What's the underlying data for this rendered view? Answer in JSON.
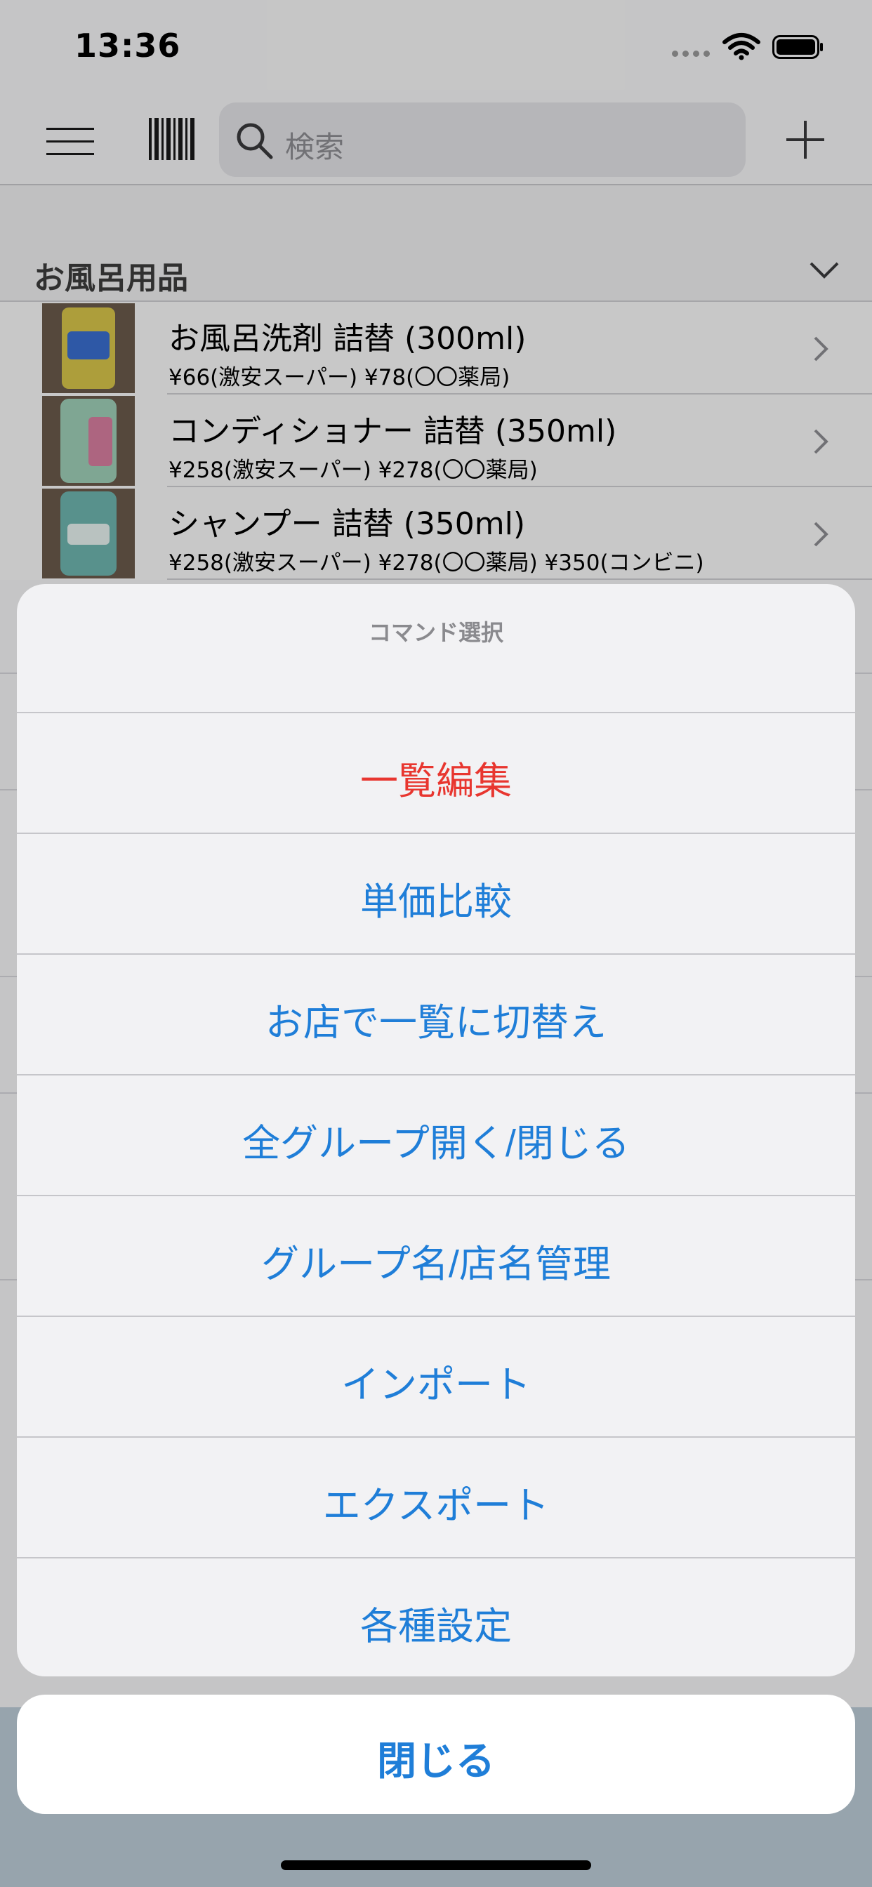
{
  "status": {
    "time": "13:36"
  },
  "nav": {
    "search_placeholder": "検索"
  },
  "section": {
    "title": "お風呂用品"
  },
  "items": [
    {
      "title": "お風呂洗剤 詰替 (300ml)",
      "prices": "¥66(激安スーパー) ¥78(〇〇薬局)",
      "thumb_color": "#d9c64a"
    },
    {
      "title": "コンディショナー 詰替 (350ml)",
      "prices": "¥258(激安スーパー) ¥278(〇〇薬局)",
      "thumb_color": "#d97fa0"
    },
    {
      "title": "シャンプー 詰替 (350ml)",
      "prices": "¥258(激安スーパー) ¥278(〇〇薬局) ¥350(コンビニ)",
      "thumb_color": "#6fb6b0"
    }
  ],
  "sheet": {
    "title": "コマンド選択",
    "actions": [
      {
        "label": "一覧編集",
        "destructive": true
      },
      {
        "label": "単価比較"
      },
      {
        "label": "お店で一覧に切替え"
      },
      {
        "label": "全グループ開く/閉じる"
      },
      {
        "label": "グループ名/店名管理"
      },
      {
        "label": "インポート"
      },
      {
        "label": "エクスポート"
      },
      {
        "label": "各種設定"
      }
    ],
    "cancel": "閉じる"
  },
  "colors": {
    "accent": "#1f7ed8",
    "destructive": "#e8362f"
  }
}
